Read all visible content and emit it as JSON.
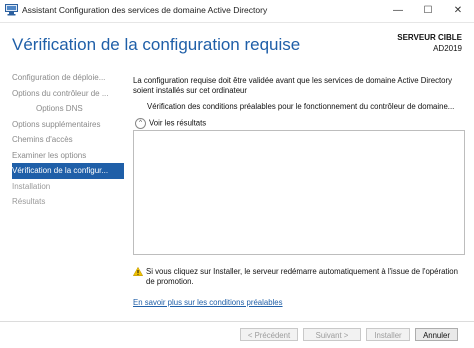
{
  "window": {
    "title": "Assistant Configuration des services de domaine Active Directory",
    "minimize": "—",
    "maximize": "☐",
    "close": "✕"
  },
  "header": {
    "title": "Vérification de la configuration requise",
    "target_label": "SERVEUR CIBLE",
    "target_name": "AD2019"
  },
  "nav": {
    "items": [
      {
        "label": "Configuration de déploie...",
        "state": "enabled"
      },
      {
        "label": "Options du contrôleur de ...",
        "state": "enabled"
      },
      {
        "label": "Options DNS",
        "state": "enabled"
      },
      {
        "label": "Options supplémentaires",
        "state": "enabled"
      },
      {
        "label": "Chemins d'accès",
        "state": "enabled"
      },
      {
        "label": "Examiner les options",
        "state": "enabled"
      },
      {
        "label": "Vérification de la configur...",
        "state": "active"
      },
      {
        "label": "Installation",
        "state": "disabled"
      },
      {
        "label": "Résultats",
        "state": "disabled"
      }
    ]
  },
  "main": {
    "intro": "La configuration requise doit être validée avant que les services de domaine Active Directory soient installés sur cet ordinateur",
    "check_status": "Vérification des conditions préalables pour le fonctionnement du contrôleur de domaine...",
    "toggle_label": "Voir les résultats",
    "toggle_glyph": "^",
    "warning_text": "Si vous cliquez sur Installer, le serveur redémarre automatiquement à l'issue de l'opération de promotion.",
    "learn_more_link": "En savoir plus sur les conditions préalables"
  },
  "footer": {
    "previous": "< Précédent",
    "next": "Suivant >",
    "install": "Installer",
    "cancel": "Annuler"
  },
  "colors": {
    "accent": "#1f5fa8",
    "warning": "#f2c200"
  }
}
